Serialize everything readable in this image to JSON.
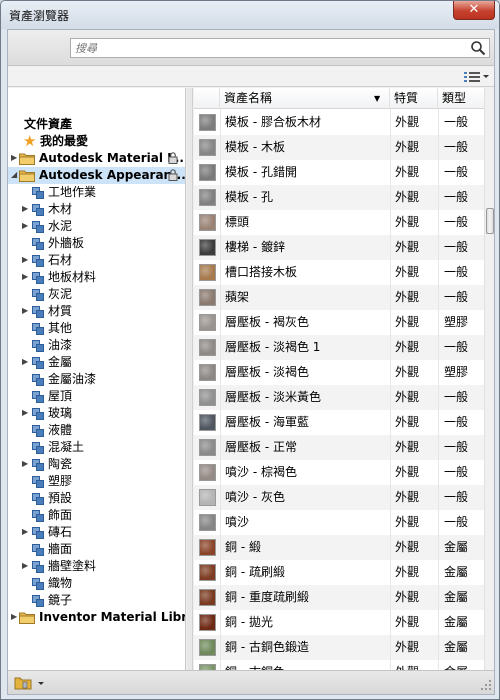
{
  "window": {
    "title": "資產瀏覽器",
    "close_symbol": "✕"
  },
  "search": {
    "placeholder": "搜尋"
  },
  "tree": {
    "document_assets": "文件資產",
    "favorites": "我的最愛",
    "libraries": [
      {
        "label": "Autodesk Material L...",
        "locked": true,
        "expanded": false,
        "selected": false
      },
      {
        "label": "Autodesk Appearan...",
        "locked": true,
        "expanded": true,
        "selected": true
      }
    ],
    "categories": [
      {
        "label": "工地作業",
        "expandable": false
      },
      {
        "label": "木材",
        "expandable": true
      },
      {
        "label": "水泥",
        "expandable": true
      },
      {
        "label": "外牆板",
        "expandable": false
      },
      {
        "label": "石材",
        "expandable": true
      },
      {
        "label": "地板材料",
        "expandable": true
      },
      {
        "label": "灰泥",
        "expandable": false
      },
      {
        "label": "材質",
        "expandable": true
      },
      {
        "label": "其他",
        "expandable": false
      },
      {
        "label": "油漆",
        "expandable": false
      },
      {
        "label": "金屬",
        "expandable": true
      },
      {
        "label": "金屬油漆",
        "expandable": false
      },
      {
        "label": "屋頂",
        "expandable": false
      },
      {
        "label": "玻璃",
        "expandable": true
      },
      {
        "label": "液體",
        "expandable": false
      },
      {
        "label": "混凝土",
        "expandable": false
      },
      {
        "label": "陶瓷",
        "expandable": true
      },
      {
        "label": "塑膠",
        "expandable": false
      },
      {
        "label": "預設",
        "expandable": false
      },
      {
        "label": "飾面",
        "expandable": false
      },
      {
        "label": "磚石",
        "expandable": true
      },
      {
        "label": "牆面",
        "expandable": false
      },
      {
        "label": "牆壁塗料",
        "expandable": true
      },
      {
        "label": "織物",
        "expandable": false
      },
      {
        "label": "鏡子",
        "expandable": false
      }
    ],
    "inventor_library": "Inventor Material Library"
  },
  "table": {
    "columns": [
      "資產名稱",
      "特質",
      "類型"
    ],
    "sort_indicator": "▼",
    "rows": [
      {
        "name": "模板 - 膠合板木材",
        "property": "外觀",
        "type": "一般",
        "swatch": "#7d7d7d"
      },
      {
        "name": "模板 - 木板",
        "property": "外觀",
        "type": "一般",
        "swatch": "#858585"
      },
      {
        "name": "模板 - 孔錯開",
        "property": "外觀",
        "type": "一般",
        "swatch": "#7a7a7a"
      },
      {
        "name": "模板 - 孔",
        "property": "外觀",
        "type": "一般",
        "swatch": "#808080"
      },
      {
        "name": "標頭",
        "property": "外觀",
        "type": "一般",
        "swatch": "#9a8275"
      },
      {
        "name": "樓梯 - 鍍鋅",
        "property": "外觀",
        "type": "一般",
        "swatch": "#3c3c3c"
      },
      {
        "name": "槽口搭接木板",
        "property": "外觀",
        "type": "一般",
        "swatch": "#a77a4e"
      },
      {
        "name": "蘋架",
        "property": "外觀",
        "type": "一般",
        "swatch": "#8a7a70"
      },
      {
        "name": "層壓板 - 褐灰色",
        "property": "外觀",
        "type": "塑膠",
        "swatch": "#9a9490"
      },
      {
        "name": "層壓板 - 淡褐色 1",
        "property": "外觀",
        "type": "一般",
        "swatch": "#8e8a86"
      },
      {
        "name": "層壓板 - 淡褐色",
        "property": "外觀",
        "type": "塑膠",
        "swatch": "#8c8884"
      },
      {
        "name": "層壓板 - 淡米黃色",
        "property": "外觀",
        "type": "一般",
        "swatch": "#909090"
      },
      {
        "name": "層壓板 - 海軍藍",
        "property": "外觀",
        "type": "一般",
        "swatch": "#4f5660"
      },
      {
        "name": "層壓板 - 正常",
        "property": "外觀",
        "type": "一般",
        "swatch": "#8a8a8a"
      },
      {
        "name": "噴沙 - 棕褐色",
        "property": "外觀",
        "type": "一般",
        "swatch": "#948a86"
      },
      {
        "name": "噴沙 - 灰色",
        "property": "外觀",
        "type": "一般",
        "swatch": "#b4b4b4"
      },
      {
        "name": "噴沙",
        "property": "外觀",
        "type": "一般",
        "swatch": "#858585"
      },
      {
        "name": "銅 - 緞",
        "property": "外觀",
        "type": "金屬",
        "swatch": "#8a4428"
      },
      {
        "name": "銅 - 疏刷緞",
        "property": "外觀",
        "type": "金屬",
        "swatch": "#7e3c22"
      },
      {
        "name": "銅 - 重度疏刷緞",
        "property": "外觀",
        "type": "金屬",
        "swatch": "#7a3a20"
      },
      {
        "name": "銅 - 拋光",
        "property": "外觀",
        "type": "金屬",
        "swatch": "#6e2a14"
      },
      {
        "name": "銅 - 古銅色鍛造",
        "property": "外觀",
        "type": "金屬",
        "swatch": "#6f8a5c"
      },
      {
        "name": "銅 - 古銅色",
        "property": "外觀",
        "type": "金屬",
        "swatch": "#7b9568"
      }
    ]
  },
  "colors": {
    "selection": "#cde3f7",
    "folder": "#e3b23c",
    "category_icon": "#4a7ebb"
  }
}
